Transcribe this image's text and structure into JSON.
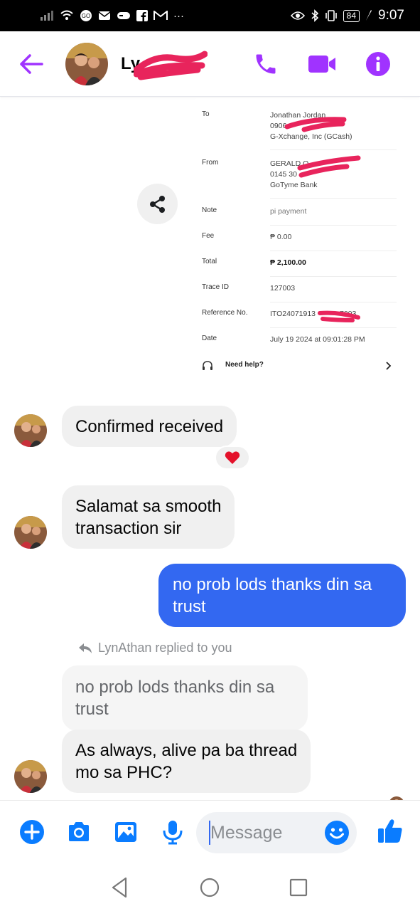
{
  "status_bar": {
    "left_icons": [
      "signal-icon",
      "wifi-icon",
      "app-icon",
      "mail-icon",
      "game-icon",
      "facebook-icon",
      "gmail-icon",
      "more-icon"
    ],
    "battery": "84",
    "time": "9:07"
  },
  "header": {
    "contact_name": "Ly",
    "icons": [
      "back-arrow-icon",
      "phone-icon",
      "video-camera-icon",
      "info-icon"
    ],
    "accent_color": "#a033ff"
  },
  "receipt": {
    "to_label": "To",
    "to_name": "Jonathan Jordan",
    "to_number": "0906",
    "to_bank": "G-Xchange, Inc (GCash)",
    "from_label": "From",
    "from_name": "GERALD Q",
    "from_number": "0145 30",
    "from_bank": "GoTyme Bank",
    "note_label": "Note",
    "note_value": "pi payment",
    "fee_label": "Fee",
    "fee_value": "₱ 0.00",
    "total_label": "Total",
    "total_value": "₱ 2,100.00",
    "trace_label": "Trace ID",
    "trace_value": "127003",
    "reference_label": "Reference No.",
    "reference_value": "ITO24071913",
    "reference_suffix": "7003",
    "date_label": "Date",
    "date_value": "July 19 2024 at 09:01:28 PM",
    "help_label": "Need help?"
  },
  "messages": {
    "confirmed": "Confirmed received",
    "reaction": "heart",
    "salamat_line1": "Salamat sa smooth",
    "salamat_line2": "transaction sir",
    "sent_line1": "no prob lods thanks din sa",
    "sent_line2": "trust",
    "reply_note": "LynAthan replied to you",
    "quoted_line1": "no prob lods thanks din sa",
    "quoted_line2": "trust",
    "last_line1": "As always, alive pa ba thread",
    "last_line2": "mo sa PHC?"
  },
  "composer": {
    "placeholder": "Message",
    "icons": [
      "plus-icon",
      "camera-icon",
      "gallery-icon",
      "microphone-icon",
      "emoji-icon",
      "thumbs-up-icon"
    ],
    "accent_color": "#0a7cff"
  },
  "colors": {
    "sent_bubble": "#3368f1",
    "received_bubble": "#f0f0f0",
    "redaction": "#e8245c"
  }
}
